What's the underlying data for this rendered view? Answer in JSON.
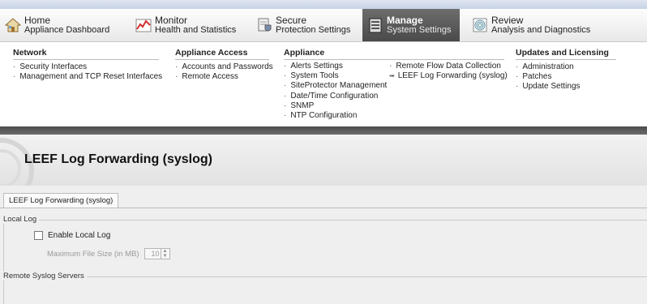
{
  "nav": {
    "items": [
      {
        "title": "Home",
        "subtitle": "Appliance Dashboard",
        "icon": "home-icon"
      },
      {
        "title": "Monitor",
        "subtitle": "Health and Statistics",
        "icon": "chart-icon"
      },
      {
        "title": "Secure",
        "subtitle": "Protection Settings",
        "icon": "shield-icon"
      },
      {
        "title": "Manage",
        "subtitle": "System Settings",
        "icon": "settings-icon"
      },
      {
        "title": "Review",
        "subtitle": "Analysis and Diagnostics",
        "icon": "fingerprint-icon"
      }
    ]
  },
  "menu": {
    "network": {
      "heading": "Network",
      "items": [
        "Security Interfaces",
        "Management and TCP Reset Interfaces"
      ]
    },
    "appliance_access": {
      "heading": "Appliance Access",
      "items": [
        "Accounts and Passwords",
        "Remote Access"
      ]
    },
    "appliance": {
      "heading": "Appliance",
      "items": [
        "Alerts Settings",
        "System Tools",
        "SiteProtector Management",
        "Date/Time Configuration",
        "SNMP",
        "NTP Configuration"
      ]
    },
    "appliance_more": {
      "items": [
        "Remote Flow Data Collection",
        "LEEF Log Forwarding (syslog)"
      ]
    },
    "updates": {
      "heading": "Updates and Licensing",
      "items": [
        "Administration",
        "Patches",
        "Update Settings"
      ]
    }
  },
  "page": {
    "title": "LEEF Log Forwarding (syslog)",
    "tab": "LEEF Log Forwarding (syslog)",
    "local_log": {
      "legend": "Local Log",
      "enable_label": "Enable Local Log",
      "enable_checked": false,
      "max_size_label": "Maximum File Size (in MB)",
      "max_size_value": "10"
    },
    "remote": {
      "legend": "Remote Syslog Servers"
    }
  },
  "colors": {
    "active_tab": "#555555",
    "band": "#5a5a5a",
    "content_bg": "#efefef"
  }
}
